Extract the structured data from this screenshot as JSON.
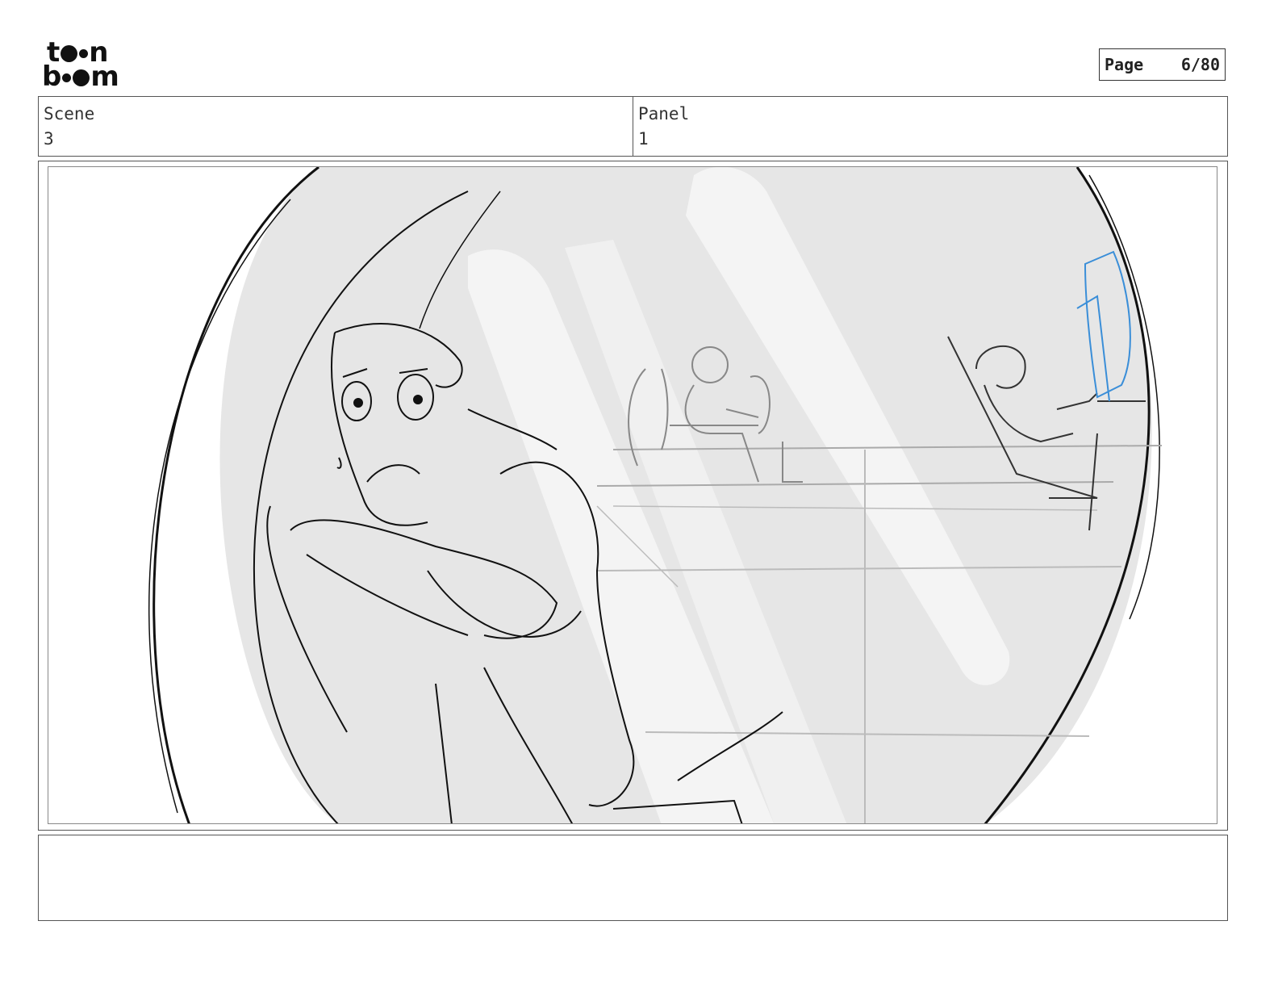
{
  "header": {
    "logo_line1": [
      "t",
      "n"
    ],
    "logo_line2": [
      "b",
      "m"
    ],
    "page_label": "Page",
    "page_number": "6/80"
  },
  "meta": {
    "scene_label": "Scene",
    "scene_value": "3",
    "panel_label": "Panel",
    "panel_value": "1"
  },
  "notes": {
    "text": ""
  }
}
